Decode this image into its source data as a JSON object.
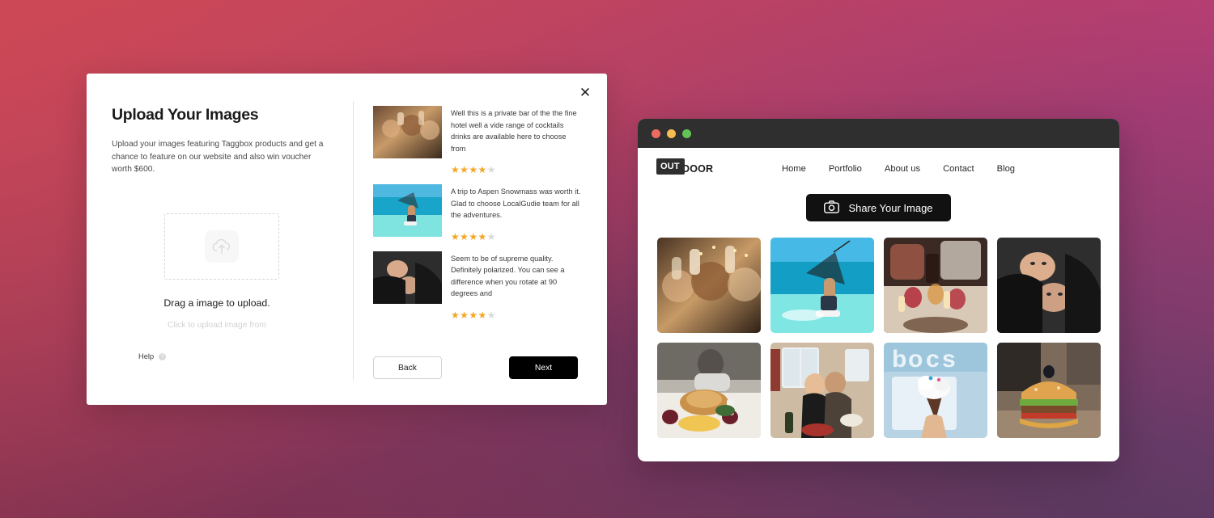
{
  "background": {
    "gradient_top_left": "#cd4856",
    "gradient_top_right": "#b03c78",
    "gradient_bottom_left": "#7c3050",
    "gradient_bottom_right": "#533a62"
  },
  "modal": {
    "close_label": "✕",
    "title": "Upload Your Images",
    "description": "Upload your images featuring Taggbox products and get a chance to feature on our website and also win voucher worth $600.",
    "dropzone": {
      "icon": "cloud-upload-icon",
      "drag_text": "Drag a image to upload.",
      "click_text": "Click to upload image from"
    },
    "help": {
      "label": "Help",
      "icon": "question-mark-icon",
      "icon_glyph": "?"
    },
    "reviews": [
      {
        "text": "Well this is a private bar of the the fine hotel well a vide range of cocktails drinks are available here to choose from",
        "rating": 4,
        "max_rating": 5,
        "thumb": "friends-toasting-drinks"
      },
      {
        "text": "A trip to Aspen Snowmass was worth it. Glad to choose LocalGudie team for all the adventures.",
        "rating": 4,
        "max_rating": 5,
        "thumb": "kitesurfer-ocean"
      },
      {
        "text": "Seem to be of supreme quality. Definitely polarized. You can see a difference when you rotate at 90 degrees and",
        "rating": 4,
        "max_rating": 5,
        "thumb": "two-people-black-outfits"
      }
    ],
    "buttons": {
      "back": "Back",
      "next": "Next"
    },
    "star_color": "#F5A623",
    "star_empty_color": "#d9d9d9",
    "star_glyph": "★"
  },
  "browser": {
    "traffic_lights": {
      "close": "#ee6a5f",
      "minimize": "#f5bd4f",
      "maximize": "#61c454"
    },
    "logo": {
      "badge_text": "OUT",
      "rest_text": "DOOR",
      "full_text": "OUTDOOR"
    },
    "nav_links": [
      "Home",
      "Portfolio",
      "About us",
      "Contact",
      "Blog"
    ],
    "share_button": {
      "label": "Share Your Image",
      "icon": "camera-icon",
      "background": "#111111"
    },
    "gallery": [
      {
        "alt": "friends-toasting-wine-glasses-party"
      },
      {
        "alt": "kitesurfer-turquoise-ocean"
      },
      {
        "alt": "pouring-wine-candlelit-table"
      },
      {
        "alt": "two-people-black-hoodies-lying-down"
      },
      {
        "alt": "roast-turkey-dinner-table"
      },
      {
        "alt": "couple-kissing-at-restaurant"
      },
      {
        "alt": "hand-holding-ice-cream-cone"
      },
      {
        "alt": "cheeseburger-with-olive"
      }
    ]
  }
}
